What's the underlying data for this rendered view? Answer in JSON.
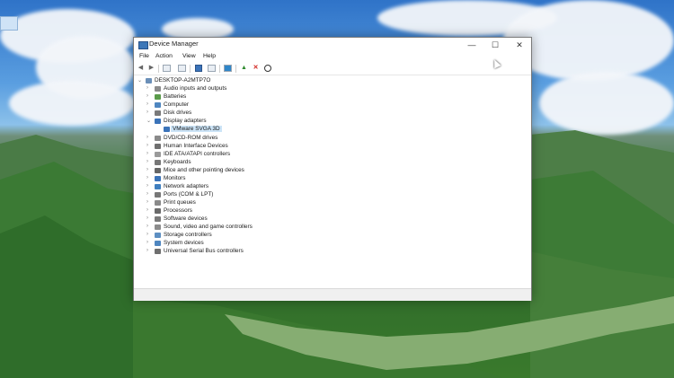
{
  "window": {
    "title": "Device Manager",
    "controls": {
      "minimize": "—",
      "maximize": "☐",
      "close": "✕"
    }
  },
  "menu": [
    "File",
    "Action",
    "View",
    "Help"
  ],
  "toolbar_icons": [
    "back-arrow-icon",
    "forward-arrow-icon",
    "show-hide-tree-icon",
    "properties-icon",
    "help-icon",
    "view-icon",
    "scan-hardware-icon",
    "update-driver-icon",
    "uninstall-icon",
    "disable-icon"
  ],
  "tree": {
    "root": "DESKTOP-A2MTP7O",
    "nodes": [
      {
        "label": "Audio inputs and outputs",
        "icon": "speaker-icon",
        "expanded": false
      },
      {
        "label": "Batteries",
        "icon": "battery-icon",
        "expanded": false
      },
      {
        "label": "Computer",
        "icon": "computer-icon",
        "expanded": false
      },
      {
        "label": "Disk drives",
        "icon": "disk-drive-icon",
        "expanded": false
      },
      {
        "label": "Display adapters",
        "icon": "display-adapter-icon",
        "expanded": true,
        "children": [
          {
            "label": "VMware SVGA 3D",
            "icon": "display-adapter-icon",
            "selected": true
          }
        ]
      },
      {
        "label": "DVD/CD-ROM drives",
        "icon": "dvd-drive-icon",
        "expanded": false
      },
      {
        "label": "Human Interface Devices",
        "icon": "hid-icon",
        "expanded": false
      },
      {
        "label": "IDE ATA/ATAPI controllers",
        "icon": "ide-controller-icon",
        "expanded": false
      },
      {
        "label": "Keyboards",
        "icon": "keyboard-icon",
        "expanded": false
      },
      {
        "label": "Mice and other pointing devices",
        "icon": "mouse-icon",
        "expanded": false
      },
      {
        "label": "Monitors",
        "icon": "monitor-icon",
        "expanded": false
      },
      {
        "label": "Network adapters",
        "icon": "network-adapter-icon",
        "expanded": false
      },
      {
        "label": "Ports (COM & LPT)",
        "icon": "port-icon",
        "expanded": false
      },
      {
        "label": "Print queues",
        "icon": "printer-icon",
        "expanded": false
      },
      {
        "label": "Processors",
        "icon": "processor-icon",
        "expanded": false
      },
      {
        "label": "Software devices",
        "icon": "software-device-icon",
        "expanded": false
      },
      {
        "label": "Sound, video and game controllers",
        "icon": "sound-controller-icon",
        "expanded": false
      },
      {
        "label": "Storage controllers",
        "icon": "storage-controller-icon",
        "expanded": false
      },
      {
        "label": "System devices",
        "icon": "system-device-icon",
        "expanded": false
      },
      {
        "label": "Universal Serial Bus controllers",
        "icon": "usb-icon",
        "expanded": false
      }
    ]
  },
  "colors": {
    "selection": "#cce4f7",
    "icon_blue": "#3b73b9",
    "window_border": "#7a7a7a"
  }
}
